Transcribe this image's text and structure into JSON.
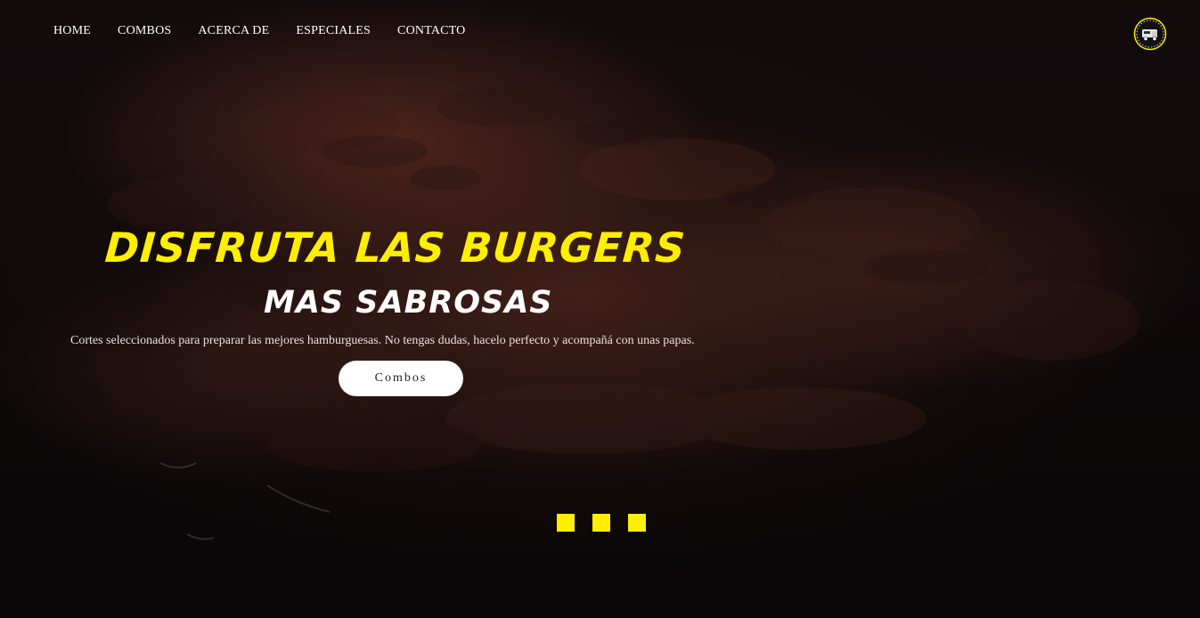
{
  "nav": {
    "items": [
      {
        "label": "HOME"
      },
      {
        "label": "COMBOS"
      },
      {
        "label": "ACERCA DE"
      },
      {
        "label": "ESPECIALES"
      },
      {
        "label": "CONTACTO"
      }
    ]
  },
  "logo": {
    "icon": "burger-truck-logo-icon"
  },
  "hero": {
    "headline": "DISFRUTA LAS BURGERS",
    "subhead": "MAS SABROSAS",
    "description": "Cortes seleccionados para preparar las mejores hamburguesas. No tengas dudas, hacelo perfecto y acompañá con unas papas.",
    "cta_label": "Combos"
  },
  "carousel": {
    "slide_count": 3
  },
  "colors": {
    "accent": "#ffee00",
    "text": "#ffffff",
    "background": "#0b0708"
  }
}
